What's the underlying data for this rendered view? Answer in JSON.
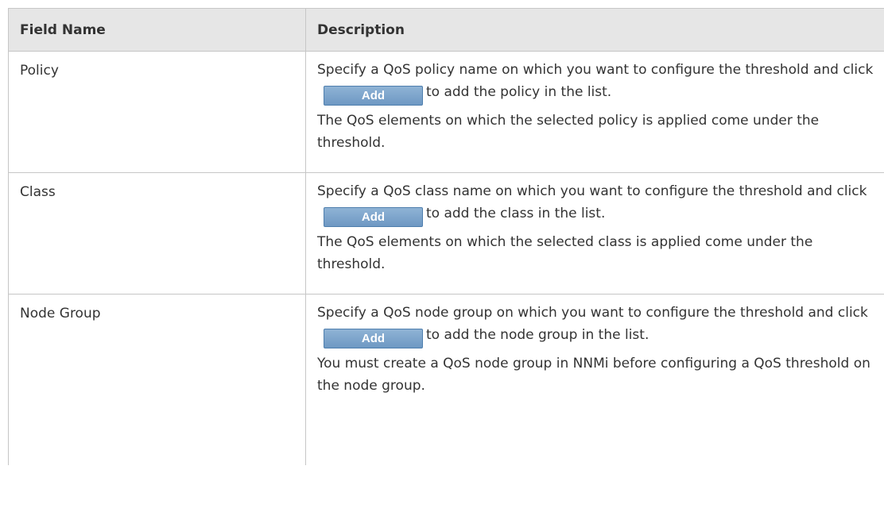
{
  "table": {
    "headers": {
      "field": "Field Name",
      "description": "Description"
    },
    "rows": [
      {
        "field": "Policy",
        "line1_pre": "Specify a QoS policy name on which you want to configure the threshold and click",
        "button": "Add",
        "line1_post": "to add the policy in the list.",
        "line2": "The QoS elements on which the selected policy is applied come under the threshold."
      },
      {
        "field": "Class",
        "line1_pre": "Specify a QoS class name on which you want to configure the threshold and click",
        "button": "Add",
        "line1_post": "to add the class in the list.",
        "line2": "The QoS elements on which the selected class is applied come under the threshold."
      },
      {
        "field": "Node Group",
        "line1_pre": "Specify a QoS node group on which you want to configure the threshold and click",
        "button": "Add",
        "line1_post": "to add the node group in the list.",
        "line2": "You must create a QoS node group in NNMi before configuring a QoS threshold on the node group."
      }
    ]
  }
}
